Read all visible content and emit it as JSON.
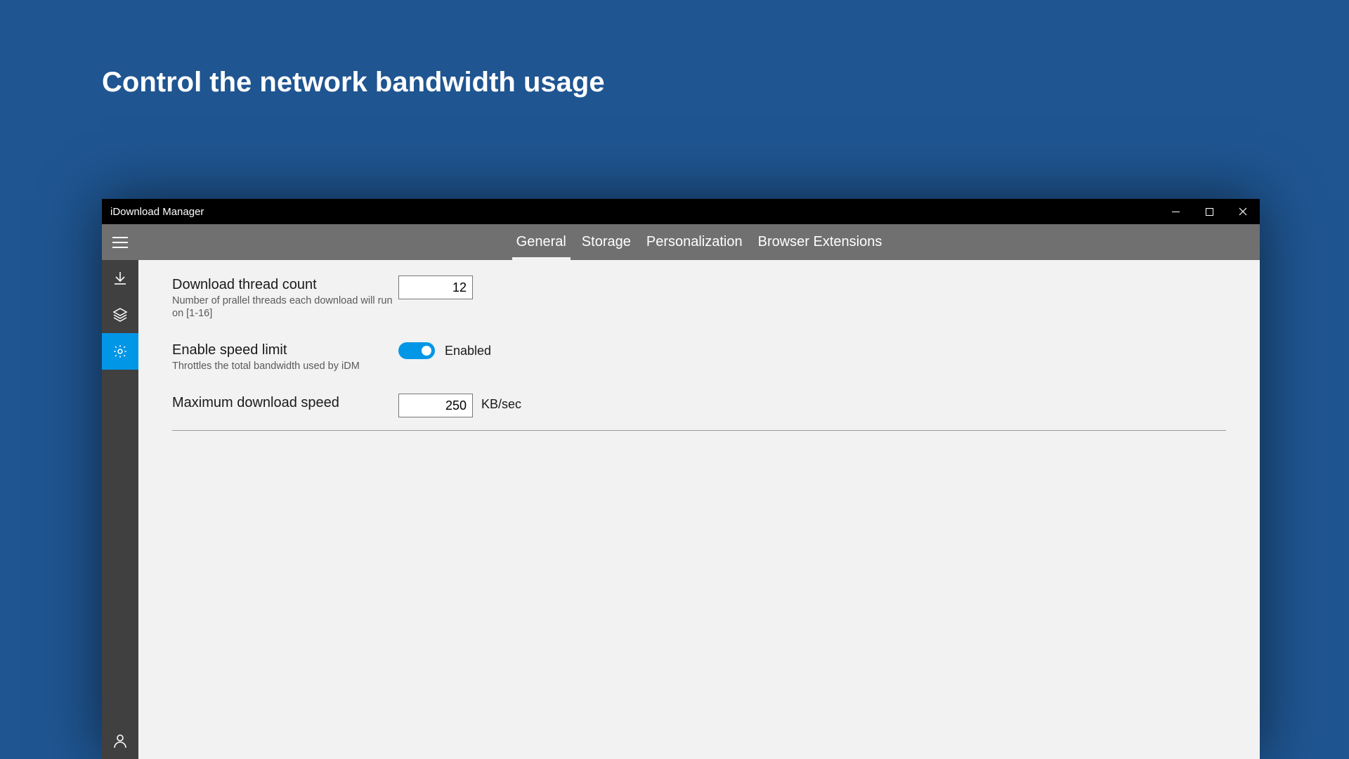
{
  "page": {
    "title": "Control the network bandwidth usage"
  },
  "window": {
    "app_title": "iDownload Manager"
  },
  "tabs": [
    {
      "label": "General",
      "active": true
    },
    {
      "label": "Storage",
      "active": false
    },
    {
      "label": "Personalization",
      "active": false
    },
    {
      "label": "Browser Extensions",
      "active": false
    }
  ],
  "sidebar": {
    "items": [
      {
        "name": "downloads",
        "active": false
      },
      {
        "name": "queue",
        "active": false
      },
      {
        "name": "settings",
        "active": true
      }
    ],
    "footer": {
      "name": "account"
    }
  },
  "settings": {
    "thread_count": {
      "title": "Download thread count",
      "desc": "Number of prallel threads each download will run on [1-16]",
      "value": "12"
    },
    "speed_limit": {
      "title": "Enable speed limit",
      "desc": "Throttles the total bandwidth used by iDM",
      "state_label": "Enabled"
    },
    "max_speed": {
      "title": "Maximum download speed",
      "value": "250",
      "unit": "KB/sec"
    }
  },
  "colors": {
    "accent": "#0296e6"
  }
}
